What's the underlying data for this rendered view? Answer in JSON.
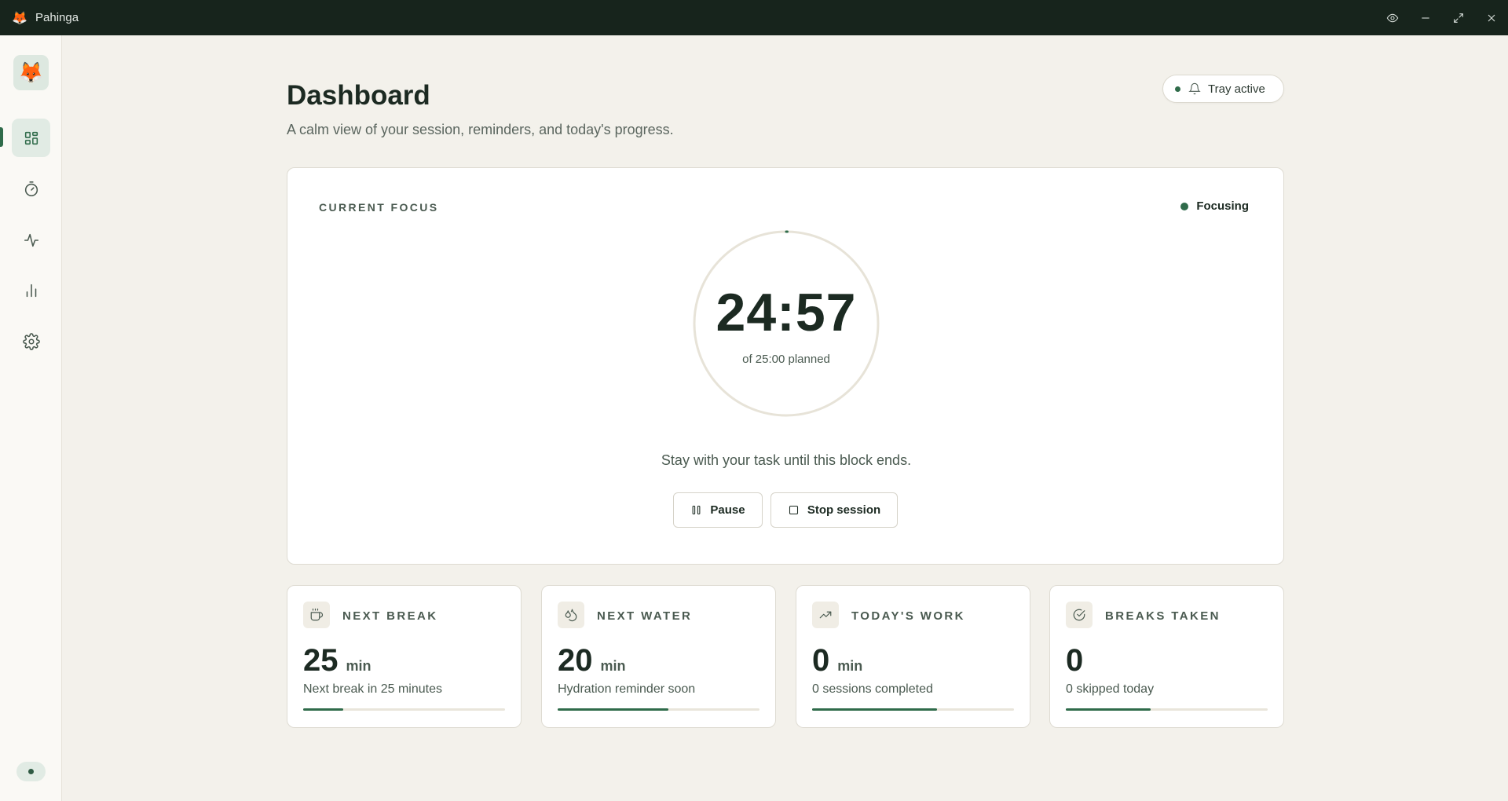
{
  "window": {
    "app_name": "Pahinga",
    "logo_icon": "fox-icon",
    "controls": [
      "eye-icon",
      "minimize-icon",
      "maximize-icon",
      "close-icon"
    ]
  },
  "sidebar": {
    "brand_icon": "fox-icon",
    "items": [
      {
        "name": "dashboard",
        "icon": "grid-icon",
        "active": true
      },
      {
        "name": "timer",
        "icon": "stopwatch-icon",
        "active": false
      },
      {
        "name": "activity",
        "icon": "pulse-icon",
        "active": false
      },
      {
        "name": "stats",
        "icon": "bar-chart-icon",
        "active": false
      },
      {
        "name": "settings",
        "icon": "gear-icon",
        "active": false
      }
    ]
  },
  "header": {
    "title": "Dashboard",
    "subtitle": "A calm view of your session, reminders, and today's progress.",
    "tray_label": "Tray active"
  },
  "focus": {
    "label": "CURRENT FOCUS",
    "state": "Focusing",
    "timer": "24:57",
    "planned": "of 25:00 planned",
    "progress": 0.002,
    "message": "Stay with your task until this block ends.",
    "pause_label": "Pause",
    "stop_label": "Stop session"
  },
  "stats": [
    {
      "label": "NEXT BREAK",
      "value": "25",
      "unit": "min",
      "desc": "Next break in 25 minutes",
      "progress": 0.2,
      "icon": "coffee-icon"
    },
    {
      "label": "NEXT WATER",
      "value": "20",
      "unit": "min",
      "desc": "Hydration reminder soon",
      "progress": 0.55,
      "icon": "droplets-icon"
    },
    {
      "label": "TODAY'S WORK",
      "value": "0",
      "unit": "min",
      "desc": "0 sessions completed",
      "progress": 0.62,
      "icon": "trending-up-icon"
    },
    {
      "label": "BREAKS TAKEN",
      "value": "0",
      "unit": "",
      "desc": "0 skipped today",
      "progress": 0.42,
      "icon": "check-circle-icon"
    }
  ],
  "colors": {
    "accent": "#2f6b4a",
    "titlebar": "#17241c",
    "background": "#f3f1eb"
  }
}
